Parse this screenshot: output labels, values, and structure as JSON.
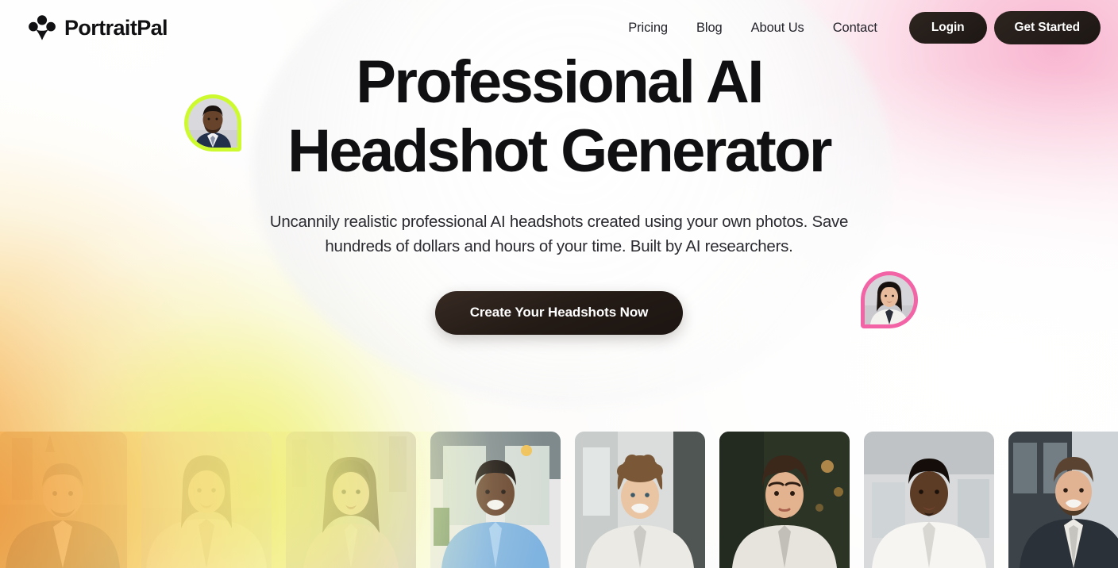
{
  "brand": {
    "name": "PortraitPal",
    "logo_icon": "people-logo-icon",
    "logo_color": "#111113"
  },
  "header": {
    "nav_links": [
      {
        "label": "Pricing"
      },
      {
        "label": "Blog"
      },
      {
        "label": "About Us"
      },
      {
        "label": "Contact"
      }
    ],
    "login_label": "Login",
    "get_started_label": "Get Started",
    "button_color": "#241c18",
    "button_text_color": "#ffffff"
  },
  "hero": {
    "title_line1": "Professional AI",
    "title_line2": "Headshot Generator",
    "subtitle": "Uncannily realistic professional AI headshots created using your own photos. Save hundreds of dollars and hours of your time. Built by AI researchers.",
    "cta_label": "Create Your Headshots Now",
    "cta_color": "#241c18"
  },
  "floating_avatars": [
    {
      "position": "left",
      "ring_color": "#cdfa2e",
      "alt": "headshot of a bearded man in a navy suit and tie"
    },
    {
      "position": "right",
      "ring_color": "#f264a6",
      "alt": "headshot of a smiling woman with long dark hair in a white blazer"
    }
  ],
  "gallery": {
    "cards": [
      {
        "alt": "smiling bearded man in dark blazer outdoors, autumn street"
      },
      {
        "alt": "smiling woman with dark wavy hair in a white shirt"
      },
      {
        "alt": "woman with shoulder-length brown hair on a city street"
      },
      {
        "alt": "smiling man in a light blue dress shirt, office interior"
      },
      {
        "alt": "smiling man with curly brown hair in a white shirt"
      },
      {
        "alt": "young man with dark hair and stubble, green bokeh background"
      },
      {
        "alt": "smiling man in a white shirt, bright office background"
      },
      {
        "alt": "smiling bearded man in a dark suit with open collar"
      }
    ]
  },
  "background": {
    "amber": "#f39d3f",
    "yellow": "#ecf06c",
    "pink": "#f8b2ce",
    "base": "#fdfcfb"
  }
}
